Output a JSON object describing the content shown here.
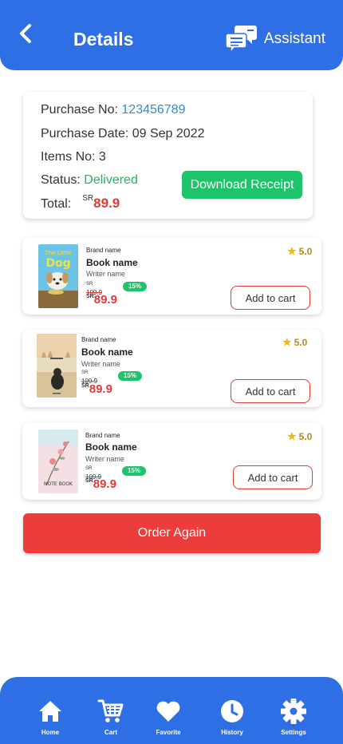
{
  "header": {
    "title": "Details",
    "assistant_label": "Assistant"
  },
  "purchase": {
    "number_label": "Purchase No:",
    "number_value": "123456789",
    "date_label": "Purchase Date:",
    "date_value": "09 Sep 2022",
    "items_label": "Items No:",
    "items_value": "3",
    "status_label": "Status:",
    "status_value": "Delivered",
    "total_label": "Total:",
    "total_currency": "SR",
    "total_value": "89.9",
    "download_label": "Download Receipt"
  },
  "books": [
    {
      "brand": "Brand name",
      "name": "Book name",
      "writer": "Writer name",
      "old_currency": "SR",
      "old_price": "109.9",
      "discount": "15%",
      "currency": "SR",
      "price": "89.9",
      "rating": "5.0",
      "cart_label": "Add to cart",
      "cover_title_1": "The Little",
      "cover_title_2": "Dog"
    },
    {
      "brand": "Brand name",
      "name": "Book name",
      "writer": "Writer name",
      "old_currency": "SR",
      "old_price": "109.9",
      "discount": "15%",
      "currency": "SR",
      "price": "89.9",
      "rating": "5.0",
      "cart_label": "Add to cart"
    },
    {
      "brand": "Brand name",
      "name": "Book name",
      "writer": "Writer name",
      "old_currency": "SR",
      "old_price": "109.9",
      "discount": "15%",
      "currency": "SR",
      "price": "89.9",
      "rating": "5.0",
      "cart_label": "Add to cart",
      "cover_title": "NOTE BOOK"
    }
  ],
  "order_again_label": "Order Again",
  "nav": [
    {
      "label": "Home",
      "icon": "home-icon"
    },
    {
      "label": "Cart",
      "icon": "cart-icon"
    },
    {
      "label": "Favorite",
      "icon": "heart-icon"
    },
    {
      "label": "History",
      "icon": "clock-icon"
    },
    {
      "label": "Settings",
      "icon": "gear-icon"
    }
  ],
  "colors": {
    "primary": "#2f6fe6",
    "accent_green": "#1ec36a",
    "accent_red": "#e53935",
    "link_blue": "#2a8be0"
  }
}
